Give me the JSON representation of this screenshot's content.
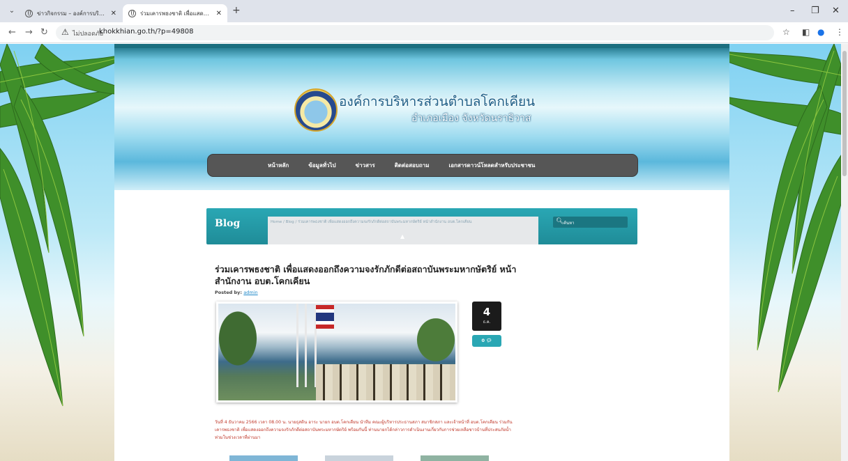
{
  "browser": {
    "tabs": [
      {
        "title": "ข่าวกิจกรรม – องค์การบริหารส่วนตำ"
      },
      {
        "title": "ร่วมเคารพธงชาติ เพื่อแสดงออกถึงค"
      }
    ],
    "new_tab_label": "+",
    "security_label": "ไม่ปลอดภัย",
    "url": "khokkhian.go.th/?p=49808"
  },
  "site": {
    "title": "องค์การบริหารส่วนตำบลโคกเคียน",
    "subtitle": "อำเภอเมือง  จังหวัดนราธิวาส",
    "menu": [
      {
        "label": "หน้าหลัก"
      },
      {
        "label": "ข้อมูลทั่วไป"
      },
      {
        "label": "ข่าวสาร"
      },
      {
        "label": "ติดต่อสอบถาม"
      },
      {
        "label": "เอกสารดาวน์โหลดสำหรับประชาชน"
      }
    ]
  },
  "blog": {
    "title": "Blog",
    "breadcrumb": "Home  /  Blog  /  ร่วมเคารพธงชาติ เพื่อแสดงออกถึงความจงรักภักดีต่อสถาบันพระมหากษัตริย์ หน้าสำนักงาน อบต.โคกเคียน",
    "search_placeholder": "ค้นหา"
  },
  "post": {
    "title": "ร่วมเคารพธงชาติ เพื่อแสดงออกถึงความจงรักภักดีต่อสถาบันพระมหากษัตริย์ หน้าสำนักงาน อบต.โคกเคียน",
    "posted_by_label": "Posted by:",
    "author": "admin",
    "date_day": "4",
    "date_month": "ธ.ค.",
    "comment_count": "0",
    "body": "วันที่ 4 ธันวาคม 2566 เวลา 08.00 น. นายธุสดิน อาระ นายก อบต.โคกเคียน นำทีม คณะผู้บริหารประธานสภา สมาชิกสภา และเจ้าหน้าที่ อบต.โคกเคียน ร่วมกันเคารพธงชาติ เพื่อแสดงออกถึงความจงรักภักดีต่อสถาบันพระมหากษัตริย์ พร้อมกันนี้ ท่านนายกได้กล่าวการดำเนินงานเกี่ยวกับการช่วยเหลือชาวบ้านที่ประสบภัยน้ำท่วมในช่วงเวลาที่ผ่านมา"
  },
  "colors": {
    "teal": "#2aa7b4",
    "menu_bg": "#565656",
    "body_text": "#c0392b"
  }
}
